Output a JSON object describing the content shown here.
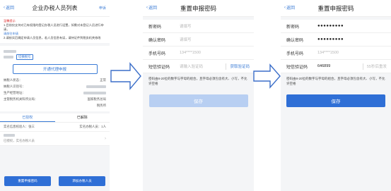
{
  "panel1": {
    "back": "返回",
    "title": "企业办税人员列表",
    "nav_right": "申诉",
    "notice_title": "温馨提示",
    "notice_lines": [
      "1.目前仅支持对已有权限的登记办税人员进行设置，如需对未登记人员进行申请，",
      "请前往申请",
      "2.请核实后确定申请人员信息，若人员信息有误，请持证件到税务机关修改"
    ],
    "switch_link": "切换税号",
    "apply_button": "开通代理申报",
    "rows": [
      {
        "label": "纳税人状态：",
        "value": "正常"
      },
      {
        "label": "纳税人识别号：",
        "value": ""
      },
      {
        "label": "生产经营地址：",
        "value": ""
      },
      {
        "label": "主管税务机关科所分局：",
        "value": "国家税务总局"
      },
      {
        "label": "",
        "value": "税务所"
      }
    ],
    "tabs": [
      "已授权",
      "已解除"
    ],
    "list": [
      "实名信息校验人：张三",
      "实名办税人员：1人",
      "张某某",
      "已授权，实名办税人员"
    ],
    "btn_left": "重置申报密码",
    "btn_right": "添加办税人员"
  },
  "panel2": {
    "back": "返回",
    "title": "重置申报密码",
    "fields": [
      {
        "label": "新密码",
        "value": "请填写"
      },
      {
        "label": "确认密码",
        "value": "请填写"
      },
      {
        "label": "手机号码",
        "value": "134****1500"
      },
      {
        "label": "短信验证码",
        "value": "请输入验证码"
      }
    ],
    "sms_button": "获取验证码",
    "hint": "密码由8-20位的数字与字母的组合，且字母必须包含有大、小写，不允许空格",
    "save": "保存"
  },
  "panel3": {
    "back": "返回",
    "title": "重置申报密码",
    "fields": [
      {
        "label": "新密码",
        "value": "●●●●●●●●●"
      },
      {
        "label": "确认密码",
        "value": "●●●●●●●●●"
      },
      {
        "label": "手机号码",
        "value": "134****1500"
      },
      {
        "label": "短信验证码",
        "value": "646899"
      }
    ],
    "sms_countdown": "55秒后重发",
    "hint": "密码由8-20位的数字与字母的组合，且字母必须包含有大、小写，不允许空格",
    "save": "保存"
  },
  "colors": {
    "accent": "#2f6fd6",
    "link": "#3a7bd5",
    "arrow": "#3b6ec9"
  }
}
